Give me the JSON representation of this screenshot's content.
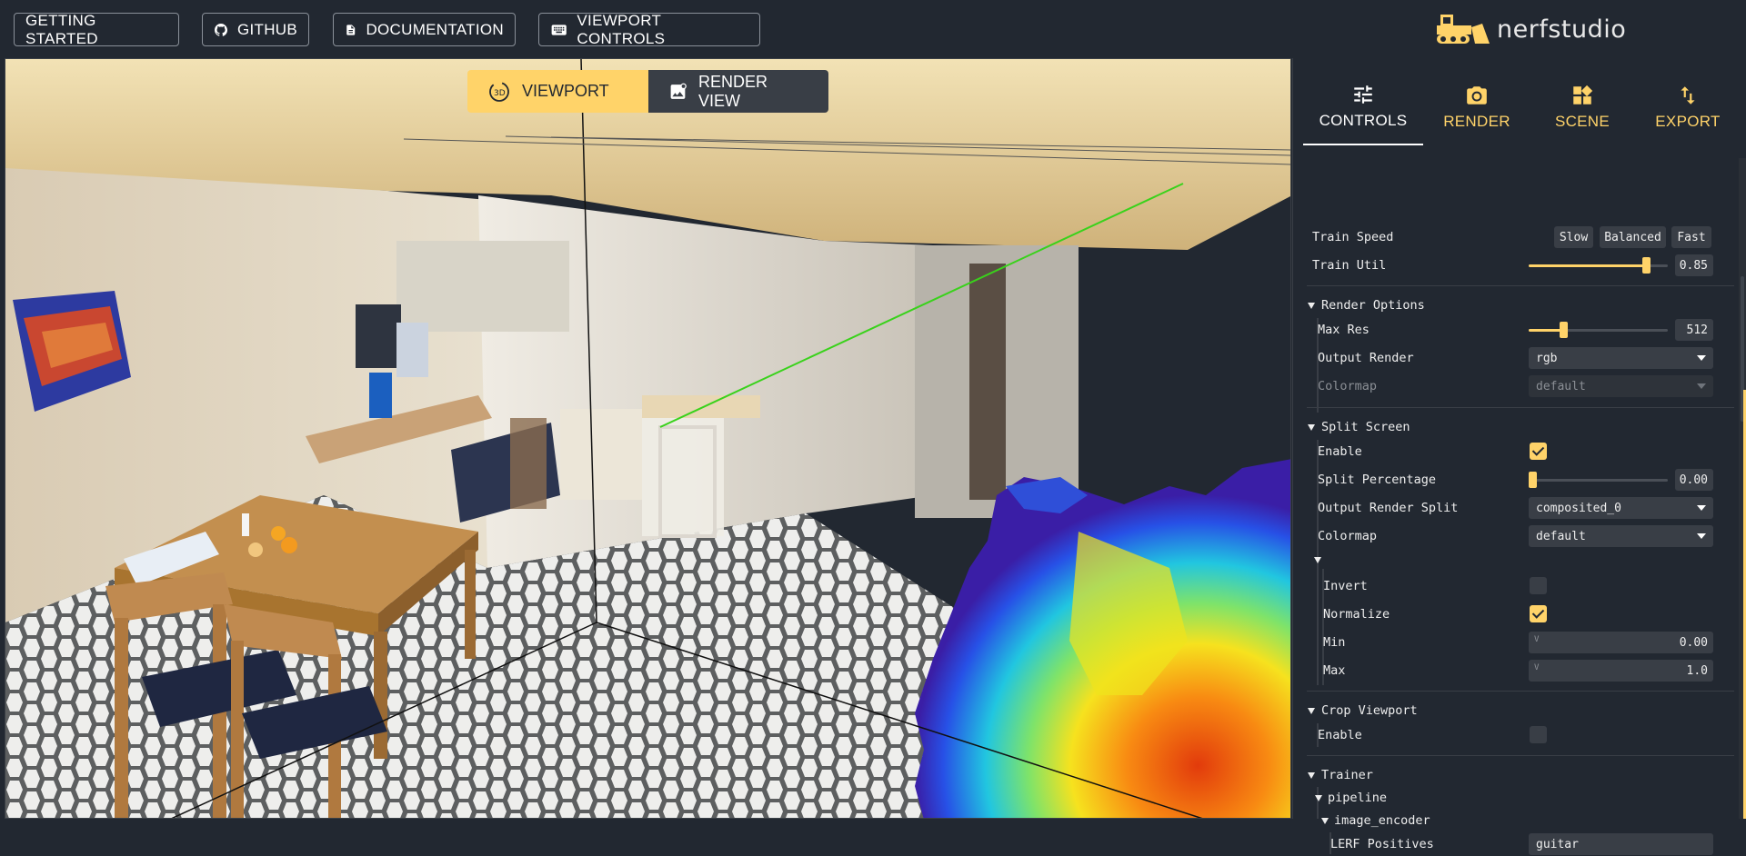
{
  "topbar": {
    "getting_started": "GETTING STARTED",
    "github": "GITHUB",
    "documentation": "DOCUMENTATION",
    "viewport_controls": "VIEWPORT CONTROLS",
    "logo_text": "nerfstudio"
  },
  "view_toggle": {
    "viewport": "VIEWPORT",
    "render_view": "RENDER VIEW",
    "active": "viewport"
  },
  "tabs": [
    {
      "label": "CONTROLS",
      "icon": "sliders-icon",
      "active": true
    },
    {
      "label": "RENDER",
      "icon": "camera-icon",
      "active": false
    },
    {
      "label": "SCENE",
      "icon": "widgets-icon",
      "active": false
    },
    {
      "label": "EXPORT",
      "icon": "import-export-icon",
      "active": false
    }
  ],
  "controls": {
    "train_speed": {
      "label": "Train Speed",
      "options": [
        "Slow",
        "Balanced",
        "Fast"
      ]
    },
    "train_util": {
      "label": "Train Util",
      "value": "0.85",
      "fraction": 0.85
    },
    "render_options": {
      "title": "Render Options",
      "max_res": {
        "label": "Max Res",
        "value": "512",
        "fraction": 0.24
      },
      "output_render": {
        "label": "Output Render",
        "value": "rgb"
      },
      "colormap": {
        "label": "Colormap",
        "value": "default",
        "disabled": true
      }
    },
    "split_screen": {
      "title": "Split Screen",
      "enable": {
        "label": "Enable",
        "checked": true
      },
      "split_percentage": {
        "label": "Split Percentage",
        "value": "0.00",
        "fraction": 0.0
      },
      "output_render_split": {
        "label": "Output Render Split",
        "value": "composited_0"
      },
      "colormap": {
        "label": "Colormap",
        "value": "default"
      },
      "invert": {
        "label": "Invert",
        "checked": false
      },
      "normalize": {
        "label": "Normalize",
        "checked": true
      },
      "min": {
        "label": "Min",
        "value": "0.00",
        "prefix": "V"
      },
      "max": {
        "label": "Max",
        "value": "1.0",
        "prefix": "V"
      }
    },
    "crop_viewport": {
      "title": "Crop Viewport",
      "enable": {
        "label": "Enable",
        "checked": false
      }
    },
    "trainer": {
      "title": "Trainer",
      "pipeline": "pipeline",
      "image_encoder": "image_encoder",
      "lerf_positives": {
        "label": "LERF Positives",
        "value": "guitar"
      }
    }
  },
  "colors": {
    "accent": "#ffd369",
    "background": "#222831",
    "surface": "#393e46"
  }
}
